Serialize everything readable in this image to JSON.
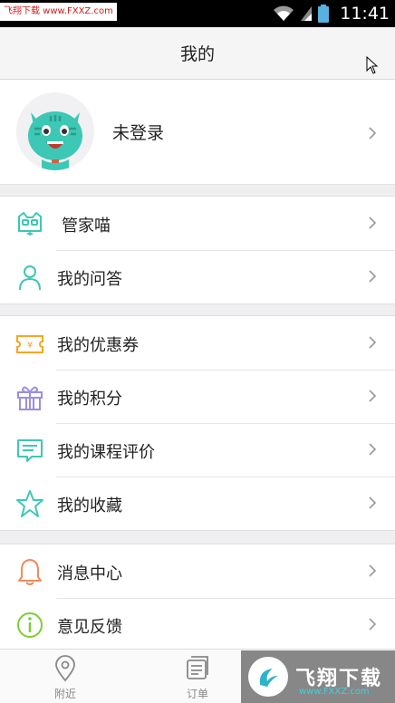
{
  "status_bar": {
    "watermark": "飞翔下载 www.FXXZ.com",
    "time": "11:41"
  },
  "header": {
    "title": "我的"
  },
  "profile": {
    "login_status": "未登录"
  },
  "groups": [
    {
      "items": [
        {
          "label": "管家喵",
          "icon": "cat-butler-icon"
        },
        {
          "label": "我的问答",
          "icon": "person-icon"
        }
      ]
    },
    {
      "items": [
        {
          "label": "我的优惠券",
          "icon": "coupon-icon"
        },
        {
          "label": "我的积分",
          "icon": "gift-icon"
        },
        {
          "label": "我的课程评价",
          "icon": "comment-icon"
        },
        {
          "label": "我的收藏",
          "icon": "star-icon"
        }
      ]
    },
    {
      "items": [
        {
          "label": "消息中心",
          "icon": "bell-icon"
        },
        {
          "label": "意见反馈",
          "icon": "info-icon"
        }
      ]
    }
  ],
  "tabbar": {
    "tabs": [
      {
        "label": "附近",
        "icon": "location-pin-icon"
      },
      {
        "label": "订单",
        "icon": "order-icon"
      }
    ]
  },
  "watermark_bottom": {
    "brand": "飞翔下载",
    "url": "www.FXXZ.com"
  },
  "colors": {
    "teal": "#3cc8b4",
    "orange": "#f5a623",
    "purple": "#9b8fe0",
    "green": "#7ccd3a",
    "salmon": "#f08a5d"
  }
}
